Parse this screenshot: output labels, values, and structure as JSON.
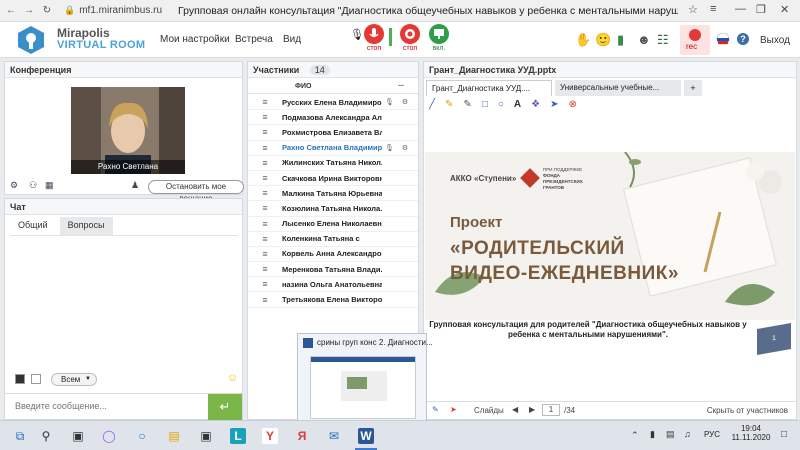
{
  "browser": {
    "url": "mf1.miranimbus.ru",
    "title": "Групповая онлайн консультация \"Диагностика общеучебных навыков у ребенка с ментальными нарушения..."
  },
  "header": {
    "brand_line1": "Mirapolis",
    "brand_line2": "VIRTUAL ROOM",
    "nav": [
      "Мои настройки",
      "Встреча",
      "Вид"
    ],
    "mic_label": "стоп",
    "cam_label": "стоп",
    "screen_label": "вкл.",
    "rec_label": "rec",
    "exit_label": "Выход"
  },
  "conference": {
    "title": "Конференция",
    "video_name": "Рахно Светлана  Владимировна",
    "stop_broadcast": "Остановить мое вещание"
  },
  "chat": {
    "title": "Чат",
    "tabs": [
      "Общий",
      "Вопросы"
    ],
    "audience": "Всем",
    "placeholder": "Введите сообщение..."
  },
  "participants": {
    "title": "Участники",
    "count": "14",
    "col_name": "ФИО",
    "col_more": "...",
    "rows": [
      "Русских Елена Владимировна",
      "Подмазова  Александра Ал...",
      "Рохмистрова  Елизавета Вл...",
      "Рахно Светлана  Владимир...",
      "Жилинских  Татьяна  Никол...",
      "Скачкова Ирина Викторовна",
      "Малкина Татьяна  Юрьевна",
      "Козюлина  Татьяна Никола...",
      "Лысенко Елена Николаевна",
      "Коленкина  Татьяна  с",
      "Корвель Анна  Александров...",
      "Меренкова  Татьяна  Влади...",
      "назина  Ольга Анатольевна",
      "Третьякова  Елена Викторо..."
    ],
    "active_index": 3
  },
  "presentation": {
    "panel_title": "Грант_Диагностика УУД.pptx",
    "tabs": [
      "Грант_Диагностика УУД....",
      "Универсальные учебные...",
      "+"
    ],
    "slide": {
      "org": "АККО «Ступени»",
      "fund_1": "ПРИ ПОДДЕРЖКЕ",
      "fund_2": "ФОНДА",
      "fund_3": "ПРЕЗИДЕНТСКИХ",
      "fund_4": "ГРАНТОВ",
      "project": "Проект",
      "title1": "«РОДИТЕЛЬСКИЙ",
      "title2": "ВИДЕО-ЕЖЕДНЕВНИК»",
      "page": "1"
    },
    "caption": "Групповая консультация для родителей \"Диагностика общеучебных навыков у ребенка с ментальными нарушениями\".",
    "slides_label": "Слайды",
    "current_slide": "1",
    "total_slides": "/34",
    "hide_label": "Скрыть от участников"
  },
  "preview": {
    "title": "срины груп конс 2. Диагности..."
  },
  "taskbar": {
    "lang": "РУС",
    "time": "19:04",
    "date": "11.11.2020"
  },
  "colors": {
    "accent_blue": "#2a73b8",
    "record_red": "#e53935",
    "send_green": "#7ab648",
    "slide_title": "#7a5a3a"
  }
}
